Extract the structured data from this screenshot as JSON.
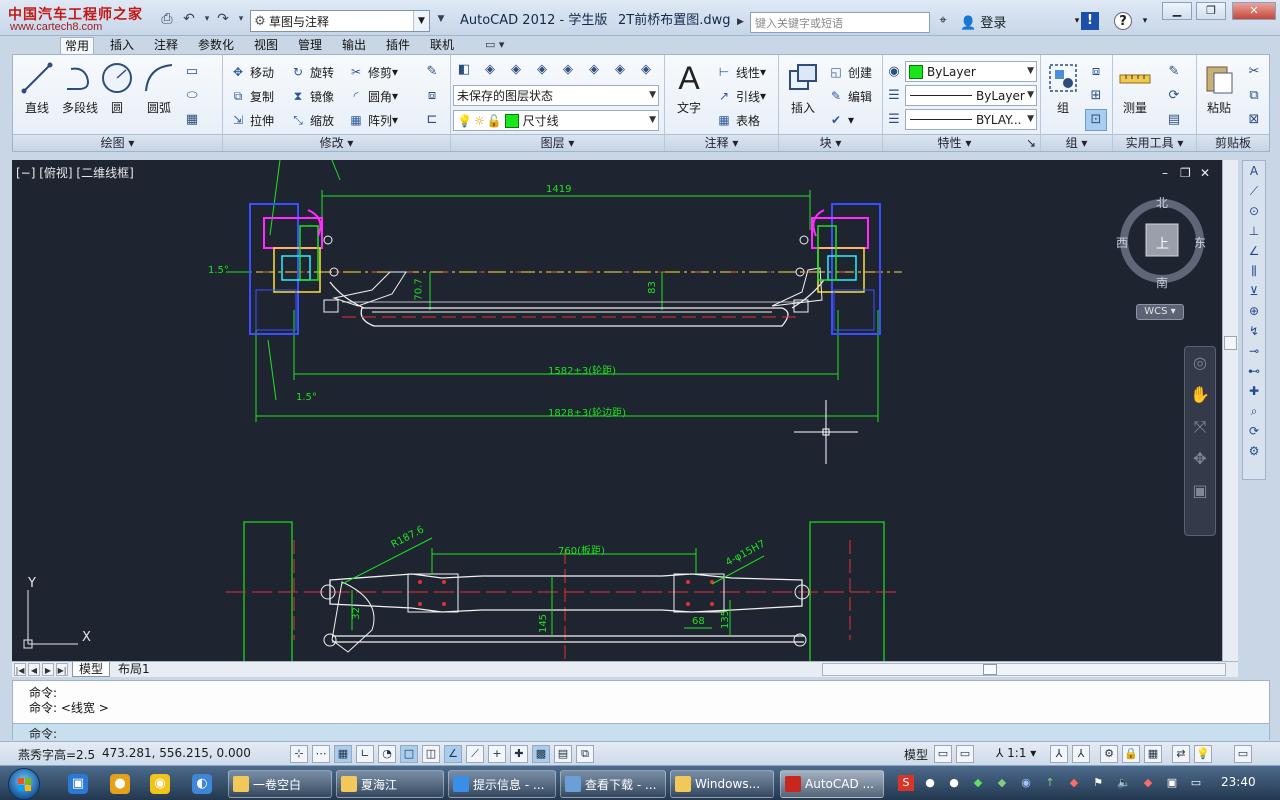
{
  "logo": {
    "line1": "中国汽车工程师之家",
    "line2": "www.cartech8.com"
  },
  "titlebar": {
    "workspace": "草图与注释",
    "app_title": "AutoCAD 2012 - 学生版",
    "file_title": "2T前桥布置图.dwg",
    "search_placeholder": "键入关键字或短语",
    "login": "登录"
  },
  "ribbon_tabs": [
    "常用",
    "插入",
    "注释",
    "参数化",
    "视图",
    "管理",
    "输出",
    "插件",
    "联机"
  ],
  "ribbon": {
    "draw": {
      "title": "绘图",
      "line": "直线",
      "polyline": "多段线",
      "circle": "圆",
      "arc": "圆弧"
    },
    "modify": {
      "title": "修改",
      "move": "移动",
      "rotate": "旋转",
      "trim": "修剪",
      "copy": "复制",
      "mirror": "镜像",
      "fillet": "圆角",
      "stretch": "拉伸",
      "scale": "缩放",
      "array": "阵列"
    },
    "layers": {
      "title": "图层",
      "layer_state": "未保存的图层状态",
      "current_layer": "尺寸线"
    },
    "annotation": {
      "title": "注释",
      "text": "文字",
      "linear": "线性",
      "leader": "引线",
      "table": "表格"
    },
    "block": {
      "title": "块",
      "insert": "插入",
      "create": "创建",
      "edit": "编辑"
    },
    "properties": {
      "title": "特性",
      "color": "ByLayer",
      "linetype": "ByLayer",
      "lineweight": "BYLAY..."
    },
    "groups": {
      "title": "组",
      "group": "组"
    },
    "utilities": {
      "title": "实用工具",
      "measure": "测量"
    },
    "clipboard": {
      "title": "剪贴板",
      "paste": "粘贴"
    }
  },
  "viewport": {
    "label": "[−] [俯视] [二维线框]",
    "viewcube": {
      "north": "北",
      "south": "南",
      "east": "东",
      "west": "西",
      "top": "上"
    },
    "wcs": "WCS"
  },
  "drawing": {
    "dim_top": "1419",
    "dim_track": "1582±3(轮距)",
    "dim_overall": "1828±3(轮边距)",
    "angle_left": "1.5°",
    "angle_bottom": "1.5°",
    "dim_h1": "70.7",
    "dim_h2": "83",
    "dim_plan": "760(板距)",
    "dim_radius": "R187.6",
    "dim_hole": "4-φ15H7",
    "dim_d1": "32",
    "dim_d2": "145",
    "dim_d3": "68",
    "dim_d4": "135"
  },
  "layout_tabs": [
    "模型",
    "布局1"
  ],
  "command": {
    "history": [
      "命令:",
      "命令:  <线宽 >"
    ],
    "prompt": "命令:"
  },
  "statusbar": {
    "font_info": "燕秀字高=2.5",
    "coords": "473.281, 556.215, 0.000",
    "model": "模型",
    "scale": "1:1"
  },
  "taskbar": {
    "items": [
      "一卷空白",
      "夏海江",
      "提示信息 - ...",
      "查看下载 - ...",
      "Windows...",
      "AutoCAD ..."
    ],
    "clock": "23:40"
  }
}
